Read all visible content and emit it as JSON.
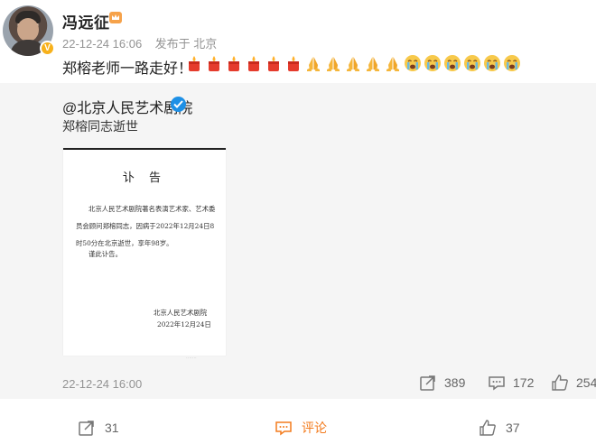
{
  "author": {
    "name": "冯远征",
    "badge_icon": "verified-v-gold",
    "crown_icon": "crown-icon"
  },
  "post": {
    "time": "22-12-24 16:06",
    "location": "发布于 北京",
    "text": "郑榕老师一路走好！",
    "emojis": [
      "candle",
      "candle",
      "candle",
      "candle",
      "candle",
      "candle",
      "pray",
      "pray",
      "pray",
      "pray",
      "pray",
      "cry",
      "cry",
      "cry",
      "cry",
      "cry",
      "cry"
    ]
  },
  "repost": {
    "author": "@北京人民艺术剧院",
    "verified_icon": "blue-verified-icon",
    "text": "郑榕同志逝世",
    "notice": {
      "title": "讣 告",
      "body": "北京人民艺术剧院著名表演艺术家、艺术委员会顾问郑榕同志，因病于2022年12月24日8时50分在北京逝世，享年98岁。",
      "closing": "谨此讣告。",
      "signature": "北京人民艺术剧院",
      "date": "2022年12月24日"
    },
    "time": "22-12-24 16:00",
    "reposts": "389",
    "comments": "172",
    "likes": "254"
  },
  "footer": {
    "reposts": "31",
    "comment_label": "评论",
    "likes": "37"
  },
  "colors": {
    "accent": "#f37b1d",
    "meta": "#939393",
    "repost_bg": "#f5f5f5",
    "verified_blue": "#1e90e6",
    "verified_gold": "#f7b11b"
  }
}
